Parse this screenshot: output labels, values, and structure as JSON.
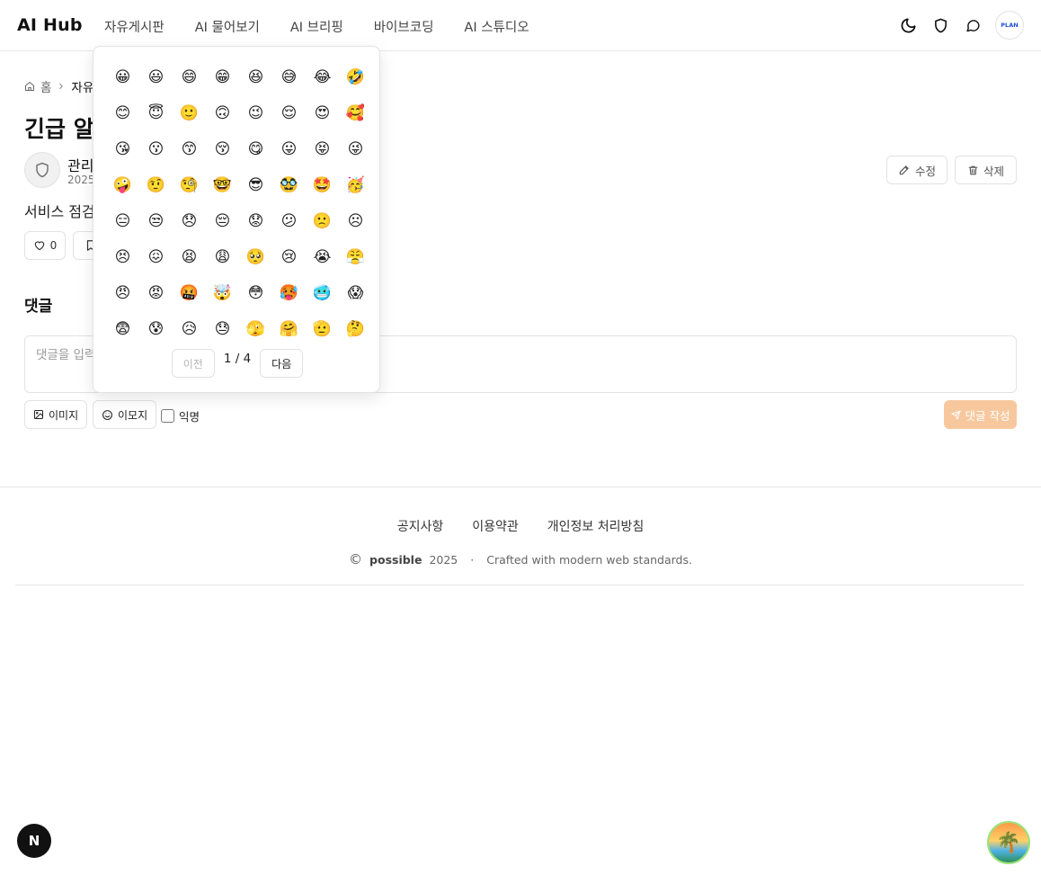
{
  "header": {
    "logo": "AI Hub",
    "nav": [
      "자유게시판",
      "AI 물어보기",
      "AI 브리핑",
      "바이브코딩",
      "AI 스튜디오"
    ],
    "avatar_text": "PLAN",
    "icons": [
      "moon-icon",
      "shield-icon",
      "chat-icon"
    ]
  },
  "breadcrumb": {
    "home": "홈",
    "current": "자유"
  },
  "post": {
    "title": "긴급 알",
    "author": "관리",
    "date": "2025",
    "body": "서비스 점검",
    "edit_label": "수정",
    "delete_label": "삭제",
    "likes": "0"
  },
  "comments": {
    "heading": "댓글",
    "placeholder": "댓글을 입력",
    "image_label": "이미지",
    "emoji_label": "이모지",
    "anonymous_label": "익명",
    "submit_label": "댓글 작성"
  },
  "emoji_picker": {
    "emojis": [
      "😀",
      "😃",
      "😄",
      "😁",
      "😆",
      "😅",
      "😂",
      "🤣",
      "😊",
      "😇",
      "🙂",
      "🙃",
      "😉",
      "😌",
      "😍",
      "🥰",
      "😘",
      "😗",
      "😙",
      "😚",
      "😋",
      "😛",
      "😝",
      "😜",
      "🤪",
      "🤨",
      "🧐",
      "🤓",
      "😎",
      "🥸",
      "🤩",
      "🥳",
      "😑",
      "😒",
      "😞",
      "😔",
      "😟",
      "😕",
      "🙁",
      "☹",
      "😣",
      "😖",
      "😫",
      "😩",
      "🥺",
      "😢",
      "😭",
      "😤",
      "😠",
      "😡",
      "🤬",
      "🤯",
      "😳",
      "🥵",
      "🥶",
      "😱",
      "😨",
      "😰",
      "😥",
      "😓",
      "🫣",
      "🤗",
      "🫡",
      "🤔"
    ],
    "prev_label": "이전",
    "next_label": "다음",
    "page_info": "1 / 4"
  },
  "footer": {
    "links": [
      "공지사항",
      "이용약관",
      "개인정보 처리방침"
    ],
    "copyright_symbol": "©",
    "brand": "possible",
    "year": "2025",
    "separator": "·",
    "tagline": "Crafted with modern web standards."
  },
  "floating": {
    "n_badge": "N"
  },
  "colors": {
    "accent_disabled": "#f7c89d",
    "border": "#e2e2e2",
    "text": "#111111"
  }
}
